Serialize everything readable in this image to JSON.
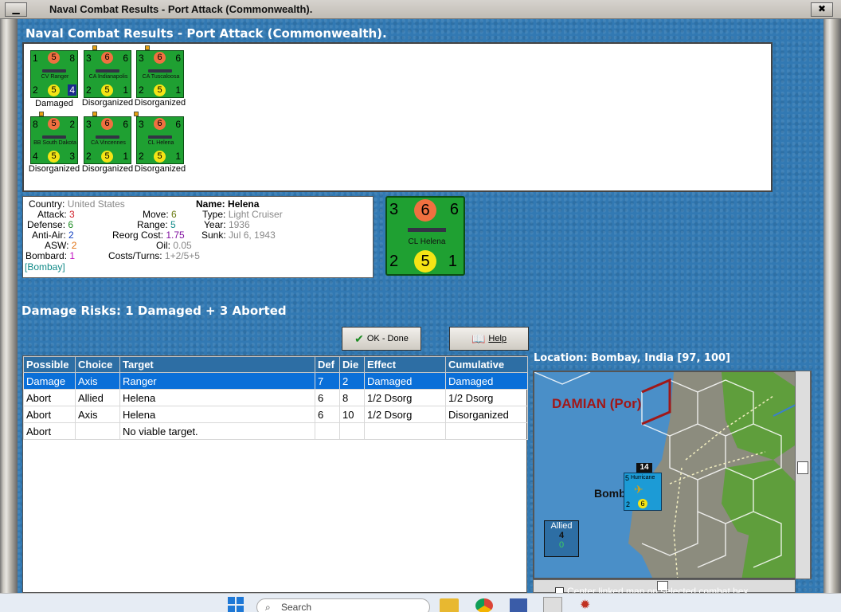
{
  "window": {
    "title": "Naval Combat Results - Port Attack (Commonwealth)."
  },
  "heading": "Naval Combat Results - Port Attack (Commonwealth).",
  "units": [
    {
      "name": "CV Ranger",
      "tl": "1",
      "tc": "5",
      "tr": "8",
      "bl": "2",
      "bc": "5",
      "br": "4",
      "status": "Damaged"
    },
    {
      "name": "CA Indianapolis",
      "tl": "3",
      "tc": "6",
      "tr": "6",
      "bl": "2",
      "bc": "5",
      "br": "1",
      "status": "Disorganized"
    },
    {
      "name": "CA Tuscaloosa",
      "tl": "3",
      "tc": "6",
      "tr": "6",
      "bl": "2",
      "bc": "5",
      "br": "1",
      "status": "Disorganized"
    },
    {
      "name": "BB South Dakota",
      "tl": "8",
      "tc": "5",
      "tr": "2",
      "bl": "4",
      "bc": "5",
      "br": "3",
      "status": "Disorganized"
    },
    {
      "name": "CA Vincennes",
      "tl": "3",
      "tc": "6",
      "tr": "6",
      "bl": "2",
      "bc": "5",
      "br": "1",
      "status": "Disorganized"
    },
    {
      "name": "CL Helena",
      "tl": "3",
      "tc": "6",
      "tr": "6",
      "bl": "2",
      "bc": "5",
      "br": "1",
      "status": "Disorganized"
    }
  ],
  "info": {
    "country_label": "Country:",
    "country": "United States",
    "attack_label": "Attack:",
    "attack": "3",
    "defense_label": "Defense:",
    "defense": "6",
    "antiair_label": "Anti-Air:",
    "antiair": "2",
    "asw_label": "ASW:",
    "asw": "2",
    "bombard_label": "Bombard:",
    "bombard": "1",
    "location": "[Bombay]",
    "move_label": "Move:",
    "move": "6",
    "range_label": "Range:",
    "range": "5",
    "reorg_label": "Reorg Cost:",
    "reorg": "1.75",
    "oil_label": "Oil:",
    "oil": "0.05",
    "costs_label": "Costs/Turns:",
    "costs": "1+2/5+5",
    "name_label": "Name:",
    "name": "Helena",
    "type_label": "Type:",
    "type": "Light Cruiser",
    "year_label": "Year:",
    "year": "1936",
    "sunk_label": "Sunk:",
    "sunk": "Jul 6, 1943"
  },
  "big_counter": {
    "name": "CL Helena",
    "tl": "3",
    "tc": "6",
    "tr": "6",
    "bl": "2",
    "bc": "5",
    "br": "1"
  },
  "damage_risks": "Damage Risks: 1 Damaged + 3 Aborted",
  "buttons": {
    "ok_label": "OK - Done",
    "help_label": "Help"
  },
  "table": {
    "headers": [
      "Possible",
      "Choice",
      "Target",
      "Def",
      "Die",
      "Effect",
      "Cumulative"
    ],
    "rows": [
      [
        "Damage",
        "Axis",
        "Ranger",
        "7",
        "2",
        "Damaged",
        "Damaged"
      ],
      [
        "Abort",
        "Allied",
        "Helena",
        "6",
        "8",
        "1/2 Dsorg",
        "1/2 Dsorg"
      ],
      [
        "Abort",
        "Axis",
        "Helena",
        "6",
        "10",
        "1/2 Dsorg",
        "Disorganized"
      ],
      [
        "Abort",
        "",
        "No viable target.",
        "",
        "",
        "",
        ""
      ]
    ]
  },
  "map": {
    "location_label": "Location:  Bombay, India [97, 100]",
    "region_label": "DAMIAN (Por)",
    "city_label": "Bomb",
    "stack_count": "14",
    "unit_name": "Hurricane",
    "unit_tl": "5",
    "unit_bl": "2",
    "unit_bc": "6",
    "allied_label": "Allied",
    "allied_count": "4",
    "allied_sub": "0"
  },
  "center_linked_label": "Center linked map on selected combat hex",
  "taskbar": {
    "search_placeholder": "Search"
  }
}
